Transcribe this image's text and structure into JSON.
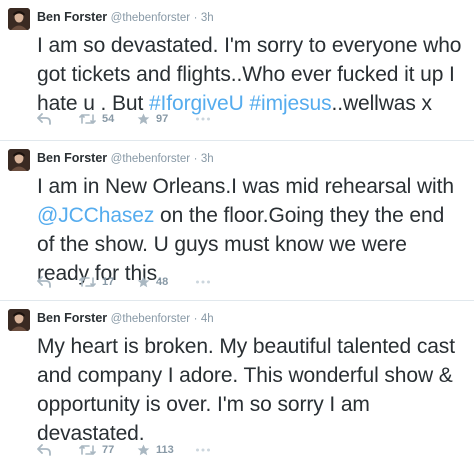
{
  "tweets": [
    {
      "name": "Ben Forster",
      "handle": "@thebenforster",
      "separator": "·",
      "time": "3h",
      "text_before": "I am so devastated.  I'm sorry to everyone who got tickets and flights..Who ever fucked it up I hate u . But ",
      "link1": "#IforgiveU",
      "text_mid": " ",
      "link2": "#imjesus",
      "text_after": "..wellwas x",
      "retweets": "54",
      "favorites": "97"
    },
    {
      "name": "Ben Forster",
      "handle": "@thebenforster",
      "separator": "·",
      "time": "3h",
      "text_before": "I am in New Orleans.I was mid rehearsal with ",
      "link1": "@JCChasez",
      "text_after": " on the floor.Going they the end of the show. U guys must know we were ready for this.",
      "retweets": "17",
      "favorites": "48"
    },
    {
      "name": "Ben Forster",
      "handle": "@thebenforster",
      "separator": "·",
      "time": "4h",
      "text": "My heart is broken. My beautiful talented cast and company I adore. This wonderful show & opportunity is over. I'm so sorry I am devastated.",
      "retweets": "77",
      "favorites": "113"
    }
  ],
  "icons": {
    "reply": "reply-icon",
    "retweet": "retweet-icon",
    "favorite": "star-icon",
    "more": "more-icon"
  },
  "colors": {
    "link": "#55acee",
    "meta": "#8899a6",
    "text": "#292f33",
    "divider": "#e1e8ed"
  }
}
